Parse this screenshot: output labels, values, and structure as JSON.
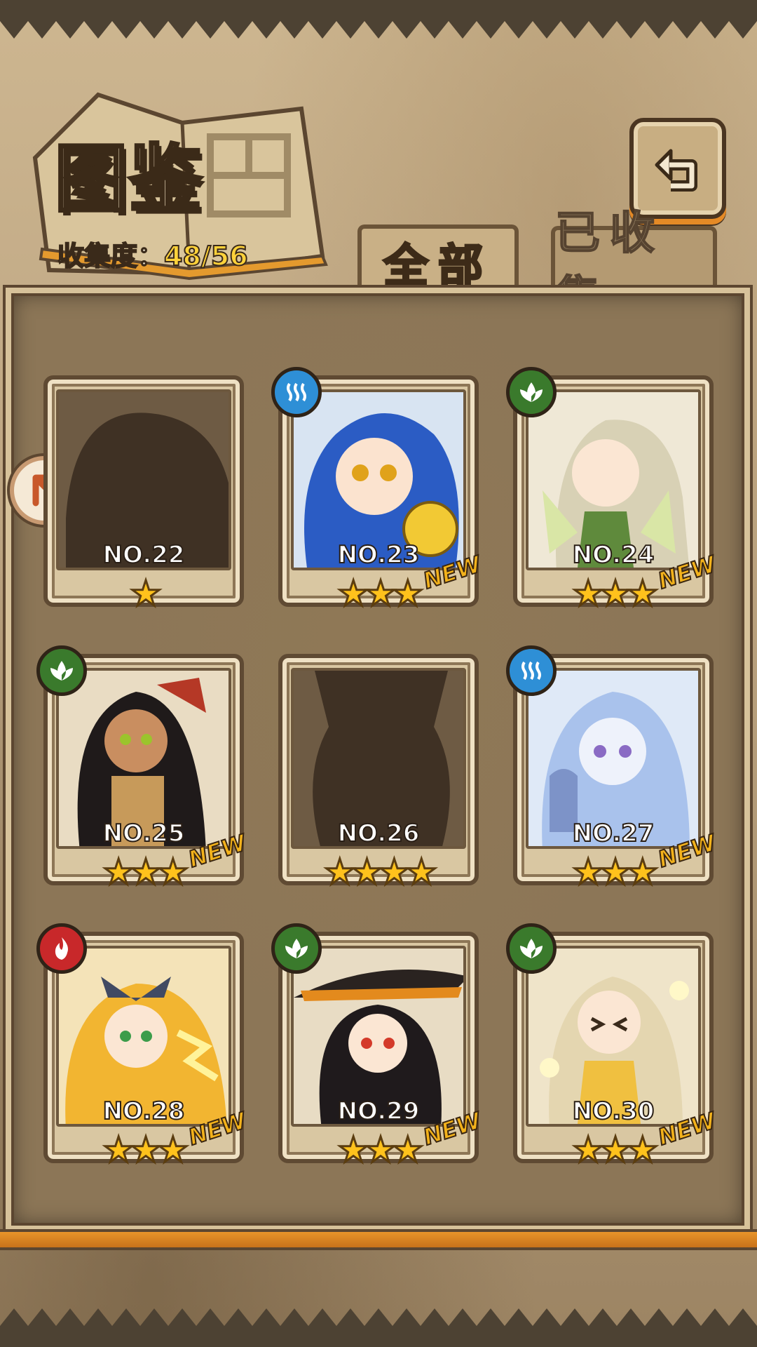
{
  "header": {
    "title": "图鉴",
    "collection_label": "收集度：",
    "collection_value": "48/56"
  },
  "tabs": [
    {
      "label": "全部",
      "active": true
    },
    {
      "label": "已收集",
      "active": false
    }
  ],
  "cards": [
    {
      "no": "NO.22",
      "stars": "★",
      "element": "",
      "new": "",
      "unlocked": false
    },
    {
      "no": "NO.23",
      "stars": "★★★",
      "element": "water",
      "new": "NEW",
      "unlocked": true
    },
    {
      "no": "NO.24",
      "stars": "★★★",
      "element": "leaf",
      "new": "NEW",
      "unlocked": true
    },
    {
      "no": "NO.25",
      "stars": "★★★",
      "element": "leaf",
      "new": "NEW",
      "unlocked": true
    },
    {
      "no": "NO.26",
      "stars": "★★★★",
      "element": "",
      "new": "",
      "unlocked": false
    },
    {
      "no": "NO.27",
      "stars": "★★★",
      "element": "water",
      "new": "NEW",
      "unlocked": true
    },
    {
      "no": "NO.28",
      "stars": "★★★",
      "element": "fire",
      "new": "NEW",
      "unlocked": true
    },
    {
      "no": "NO.29",
      "stars": "★★★",
      "element": "leaf",
      "new": "NEW",
      "unlocked": true
    },
    {
      "no": "NO.30",
      "stars": "★★★",
      "element": "leaf",
      "new": "NEW",
      "unlocked": true
    }
  ],
  "icons": {
    "back": "back-arrow-icon",
    "side_arrow": "page-prev-arrow-icon"
  },
  "colors": {
    "accent_gold": "#ffd23a",
    "water": "#2e8fd6",
    "leaf": "#3a7a2c",
    "fire": "#c8282a"
  }
}
